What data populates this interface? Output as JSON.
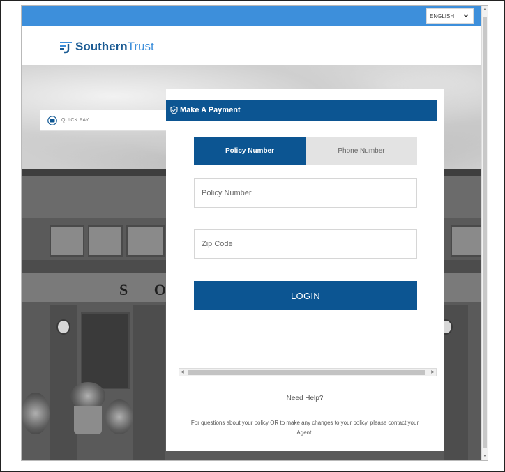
{
  "language_select": {
    "value": "ENGLISH"
  },
  "brand": {
    "name_bold": "Southern",
    "name_light": "Trust",
    "color": "#1b5b93",
    "accent": "#3d8fdb"
  },
  "quick_pay": {
    "label": "QUICK PAY"
  },
  "panel": {
    "title": "Make A Payment",
    "tabs": [
      {
        "label": "Policy Number",
        "active": true
      },
      {
        "label": "Phone Number",
        "active": false
      }
    ],
    "fields": {
      "policy_number": {
        "placeholder": "Policy Number",
        "value": ""
      },
      "zip_code": {
        "placeholder": "Zip Code",
        "value": ""
      }
    },
    "login_label": "LOGIN"
  },
  "help": {
    "title": "Need Help?",
    "text": "For questions about your policy OR to make any changes to your policy, please contact your Agent."
  },
  "background_sign": "S O",
  "colors": {
    "primary": "#0c5592",
    "topbar": "#3d8fdb",
    "inactive_tab": "#e3e3e3"
  },
  "icons": [
    "chevron-down-icon",
    "logo-mark-icon",
    "card-icon",
    "shield-check-icon",
    "arrow-up-icon",
    "arrow-down-icon",
    "arrow-left-icon",
    "arrow-right-icon"
  ]
}
